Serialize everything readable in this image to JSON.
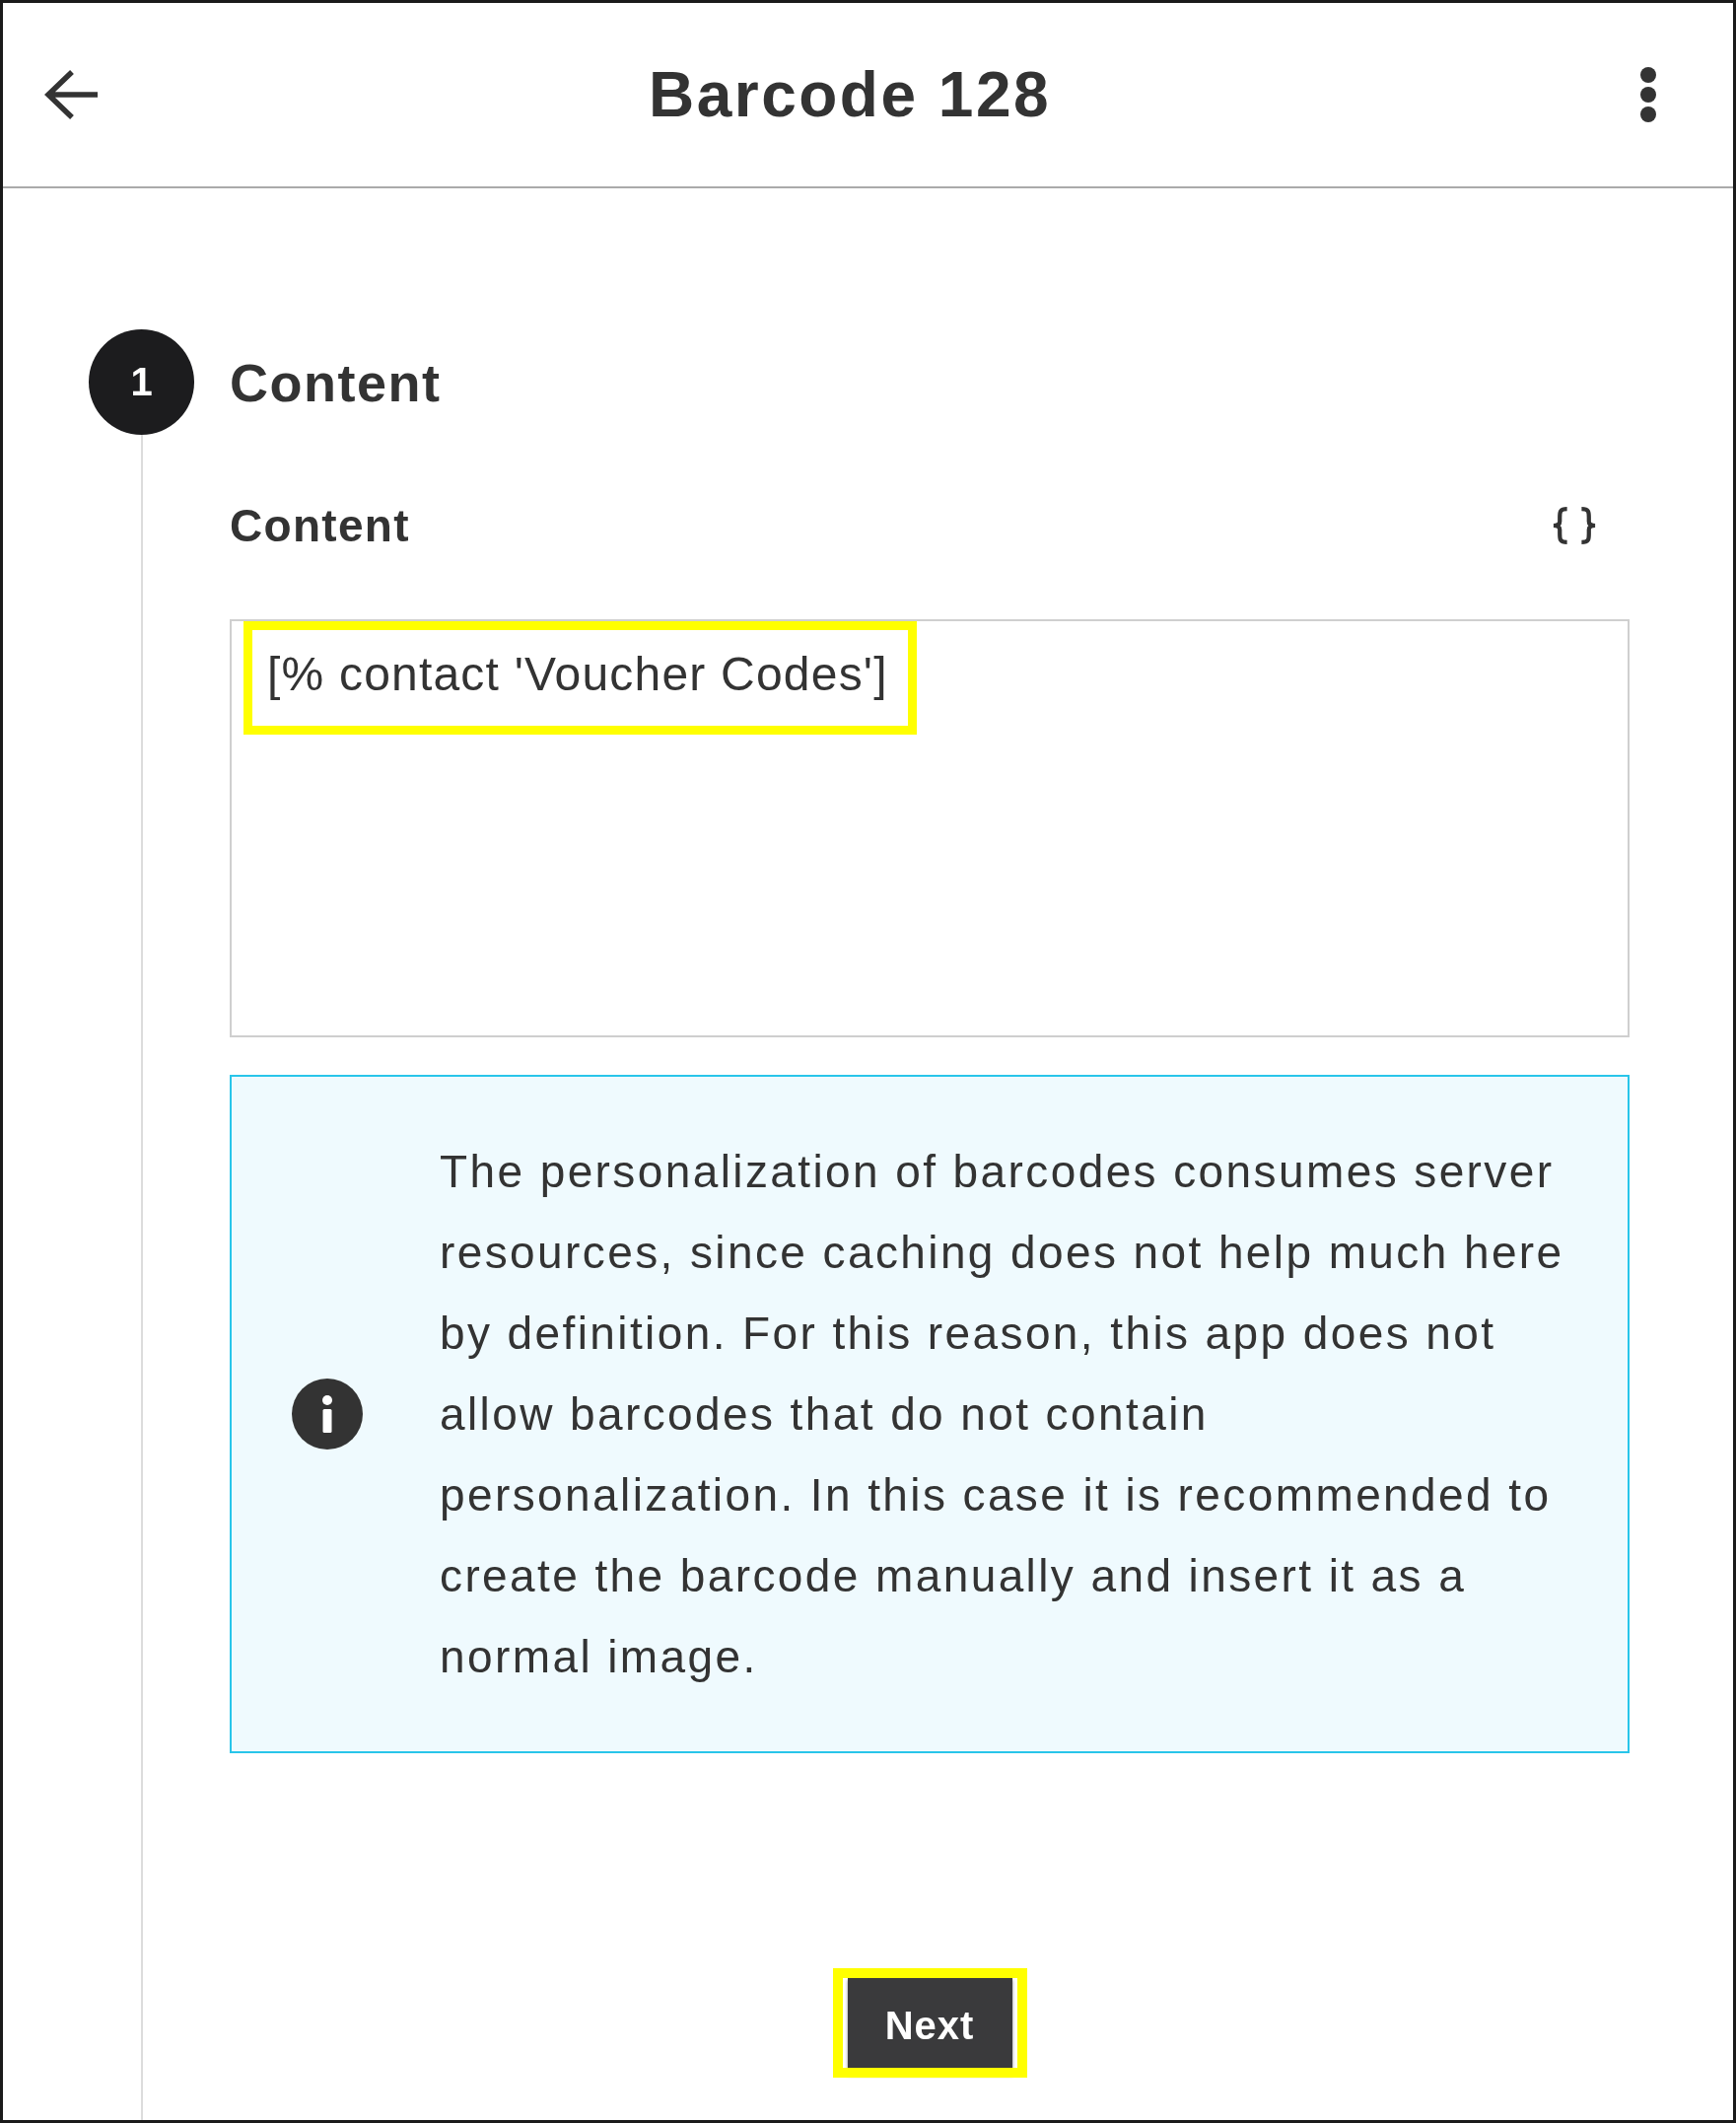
{
  "header": {
    "title": "Barcode 128"
  },
  "step": {
    "number": "1",
    "title": "Content"
  },
  "field": {
    "label": "Content",
    "value": "[% contact 'Voucher Codes']",
    "highlighted": true
  },
  "info": {
    "text": "The personalization of barcodes consumes server resources, since caching does not help much here by definition. For this reason, this app does not allow barcodes that do not contain personalization. In this case it is recommended to create the barcode manually and insert it as a normal image."
  },
  "next_button": {
    "label": "Next",
    "highlighted": true
  }
}
